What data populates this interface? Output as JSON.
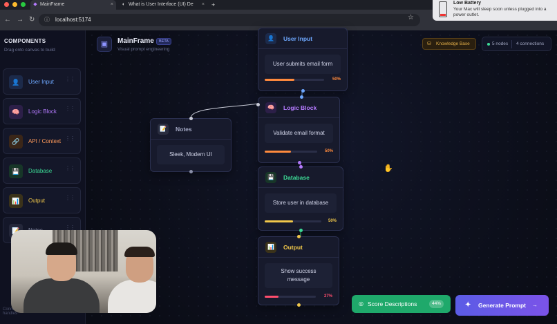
{
  "browser": {
    "tabs": [
      {
        "title": "MainFrame",
        "favicon": "◆"
      },
      {
        "title": "What is User Interface (UI) De",
        "favicon": "◐"
      }
    ],
    "new_tab": "+",
    "url": "localhost:5174"
  },
  "notification": {
    "title": "Low Battery",
    "message": "Your Mac will sleep soon unless plugged into a power outlet."
  },
  "sidebar": {
    "title": "COMPONENTS",
    "subtitle": "Drag onto canvas to build",
    "items": [
      {
        "label": "User Input",
        "icon": "user-icon",
        "glyph": "👤",
        "color": "#6ea8ff"
      },
      {
        "label": "Logic Block",
        "icon": "brain-icon",
        "glyph": "🧠",
        "color": "#b57bff"
      },
      {
        "label": "API / Context",
        "icon": "link-icon",
        "glyph": "🔗",
        "color": "#ff9a5a"
      },
      {
        "label": "Database",
        "icon": "floppy-icon",
        "glyph": "💾",
        "color": "#3ddc97"
      },
      {
        "label": "Output",
        "icon": "chart-icon",
        "glyph": "📊",
        "color": "#f1c84b"
      },
      {
        "label": "Notes",
        "icon": "note-icon",
        "glyph": "📝",
        "color": "#8a8fa8"
      }
    ],
    "footer": "Connect nodes by dragging between handles"
  },
  "header": {
    "brand": "MainFrame",
    "badge": "BETA",
    "tagline": "Visual prompt engineering",
    "knowledge_base": "Knowledge Base",
    "nodes_count": "5 nodes",
    "connections_count": "4 connections"
  },
  "nodes": [
    {
      "title": "User Input",
      "content": "User submits email form",
      "progress": 50,
      "progress_label": "50%",
      "color": "#6ea8ff",
      "bar": "#ff8a3d"
    },
    {
      "title": "Logic Block",
      "content": "Validate email format",
      "progress": 50,
      "progress_label": "50%",
      "color": "#b57bff",
      "bar": "#ff8a3d"
    },
    {
      "title": "Database",
      "content": "Store user in database",
      "progress": 50,
      "progress_label": "50%",
      "color": "#3ddc97",
      "bar": "#f1c84b"
    },
    {
      "title": "Output",
      "content": "Show success message",
      "progress": 27,
      "progress_label": "27%",
      "color": "#f1c84b",
      "bar": "#ff4d6d"
    },
    {
      "title": "Notes",
      "content": "Sleek, Modern UI",
      "color": "#a3a8c3"
    }
  ],
  "actions": {
    "score": "Score Descriptions",
    "score_badge": "44%",
    "generate": "Generate Prompt"
  }
}
